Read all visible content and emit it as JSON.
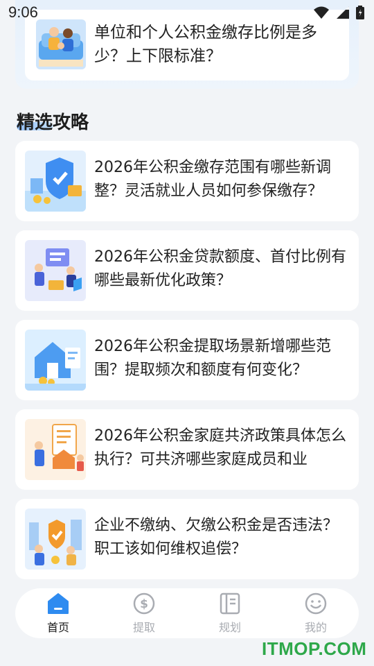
{
  "status_bar": {
    "time": "9:06",
    "icons": [
      "wifi-icon",
      "signal-icon",
      "battery-icon"
    ]
  },
  "top_item": {
    "title": "单位和个人公积金缴存比例是多少？上下限标准？"
  },
  "section": {
    "title": "精选攻略"
  },
  "articles": [
    {
      "title": "2026年公积金缴存范围有哪些新调整？灵活就业人员如何参保缴存？"
    },
    {
      "title": "2026年公积金贷款额度、首付比例有哪些最新优化政策？"
    },
    {
      "title": "2026年公积金提取场景新增哪些范围？提取频次和额度有何变化？"
    },
    {
      "title": "2026年公积金家庭共济政策具体怎么执行？可共济哪些家庭成员和业"
    },
    {
      "title": "企业不缴纳、欠缴公积金是否违法？职工该如何维权追偿？"
    }
  ],
  "nav": {
    "items": [
      {
        "label": "首页",
        "icon": "home-icon",
        "active": true
      },
      {
        "label": "提取",
        "icon": "dollar-icon",
        "active": false
      },
      {
        "label": "规划",
        "icon": "document-icon",
        "active": false
      },
      {
        "label": "我的",
        "icon": "smile-icon",
        "active": false
      }
    ]
  },
  "colors": {
    "accent": "#2e8bf0",
    "nav_inactive": "#a9acb2",
    "watermark": "#2ea84a"
  },
  "watermark": "ITMOP.COM"
}
